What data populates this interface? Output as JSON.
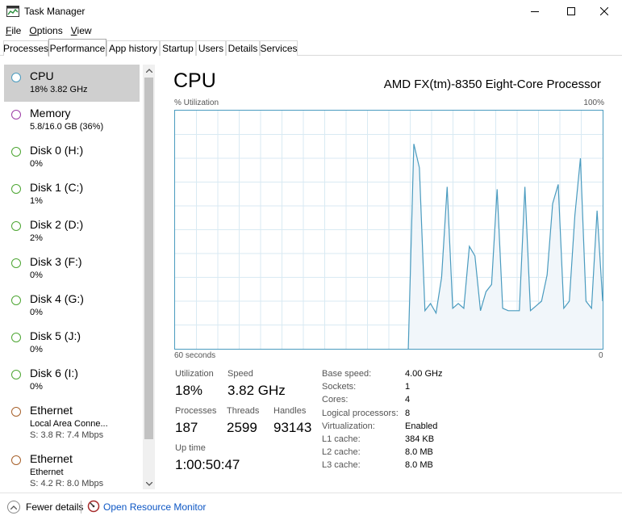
{
  "window": {
    "title": "Task Manager"
  },
  "menu": [
    {
      "ul": "F",
      "rest": "ile"
    },
    {
      "ul": "O",
      "rest": "ptions"
    },
    {
      "ul": "V",
      "rest": "iew"
    }
  ],
  "tabs": [
    "Processes",
    "Performance",
    "App history",
    "Startup",
    "Users",
    "Details",
    "Services"
  ],
  "sidebar": [
    {
      "title": "CPU",
      "sub": "18%  3.82 GHz",
      "sub2": "",
      "color": "#4a9bbf",
      "selected": true
    },
    {
      "title": "Memory",
      "sub": "5.8/16.0 GB (36%)",
      "sub2": "",
      "color": "#9c3ba5",
      "selected": false
    },
    {
      "title": "Disk 0 (H:)",
      "sub": "0%",
      "sub2": "",
      "color": "#4da633",
      "selected": false
    },
    {
      "title": "Disk 1 (C:)",
      "sub": "1%",
      "sub2": "",
      "color": "#4da633",
      "selected": false
    },
    {
      "title": "Disk 2 (D:)",
      "sub": "2%",
      "sub2": "",
      "color": "#4da633",
      "selected": false
    },
    {
      "title": "Disk 3 (F:)",
      "sub": "0%",
      "sub2": "",
      "color": "#4da633",
      "selected": false
    },
    {
      "title": "Disk 4 (G:)",
      "sub": "0%",
      "sub2": "",
      "color": "#4da633",
      "selected": false
    },
    {
      "title": "Disk 5 (J:)",
      "sub": "0%",
      "sub2": "",
      "color": "#4da633",
      "selected": false
    },
    {
      "title": "Disk 6 (I:)",
      "sub": "0%",
      "sub2": "",
      "color": "#4da633",
      "selected": false
    },
    {
      "title": "Ethernet",
      "sub": "Local Area Conne...",
      "sub2": "S: 3.8  R: 7.4 Mbps",
      "color": "#a7612b",
      "selected": false
    },
    {
      "title": "Ethernet",
      "sub": "Ethernet",
      "sub2": "S: 4.2  R: 8.0 Mbps",
      "color": "#a7612b",
      "selected": false
    }
  ],
  "main": {
    "title": "CPU",
    "processor": "AMD FX(tm)-8350 Eight-Core Processor",
    "graph_label": "% Utilization",
    "graph_max": "100%",
    "graph_time": "60 seconds",
    "graph_min": "0",
    "graph_color": "#4a9bbf",
    "graph_values": [
      null,
      null,
      null,
      null,
      null,
      null,
      null,
      null,
      null,
      null,
      null,
      null,
      null,
      null,
      null,
      null,
      null,
      null,
      null,
      null,
      null,
      null,
      null,
      null,
      null,
      null,
      null,
      null,
      null,
      null,
      null,
      null,
      null,
      null,
      null,
      null,
      null,
      null,
      null,
      null,
      null,
      null,
      0,
      86,
      76,
      16,
      19,
      15,
      30,
      68,
      17,
      19,
      17,
      43,
      39,
      16,
      24,
      27,
      67,
      17,
      16,
      16,
      16,
      68,
      16,
      18,
      20,
      31,
      61,
      69,
      17,
      20,
      56,
      80,
      20,
      17,
      58,
      20
    ]
  },
  "stats": {
    "utilization": {
      "label": "Utilization",
      "value": "18%"
    },
    "speed": {
      "label": "Speed",
      "value": "3.82 GHz"
    },
    "processes": {
      "label": "Processes",
      "value": "187"
    },
    "threads": {
      "label": "Threads",
      "value": "2599"
    },
    "handles": {
      "label": "Handles",
      "value": "93143"
    },
    "uptime": {
      "label": "Up time",
      "value": "1:00:50:47"
    }
  },
  "specs": [
    {
      "label": "Base speed:",
      "value": "4.00 GHz"
    },
    {
      "label": "Sockets:",
      "value": "1"
    },
    {
      "label": "Cores:",
      "value": "4"
    },
    {
      "label": "Logical processors:",
      "value": "8"
    },
    {
      "label": "Virtualization:",
      "value": "Enabled"
    },
    {
      "label": "L1 cache:",
      "value": "384 KB"
    },
    {
      "label": "L2 cache:",
      "value": "8.0 MB"
    },
    {
      "label": "L3 cache:",
      "value": "8.0 MB"
    }
  ],
  "footer": {
    "fewer_details": "Fewer details",
    "resource_monitor": "Open Resource Monitor"
  }
}
